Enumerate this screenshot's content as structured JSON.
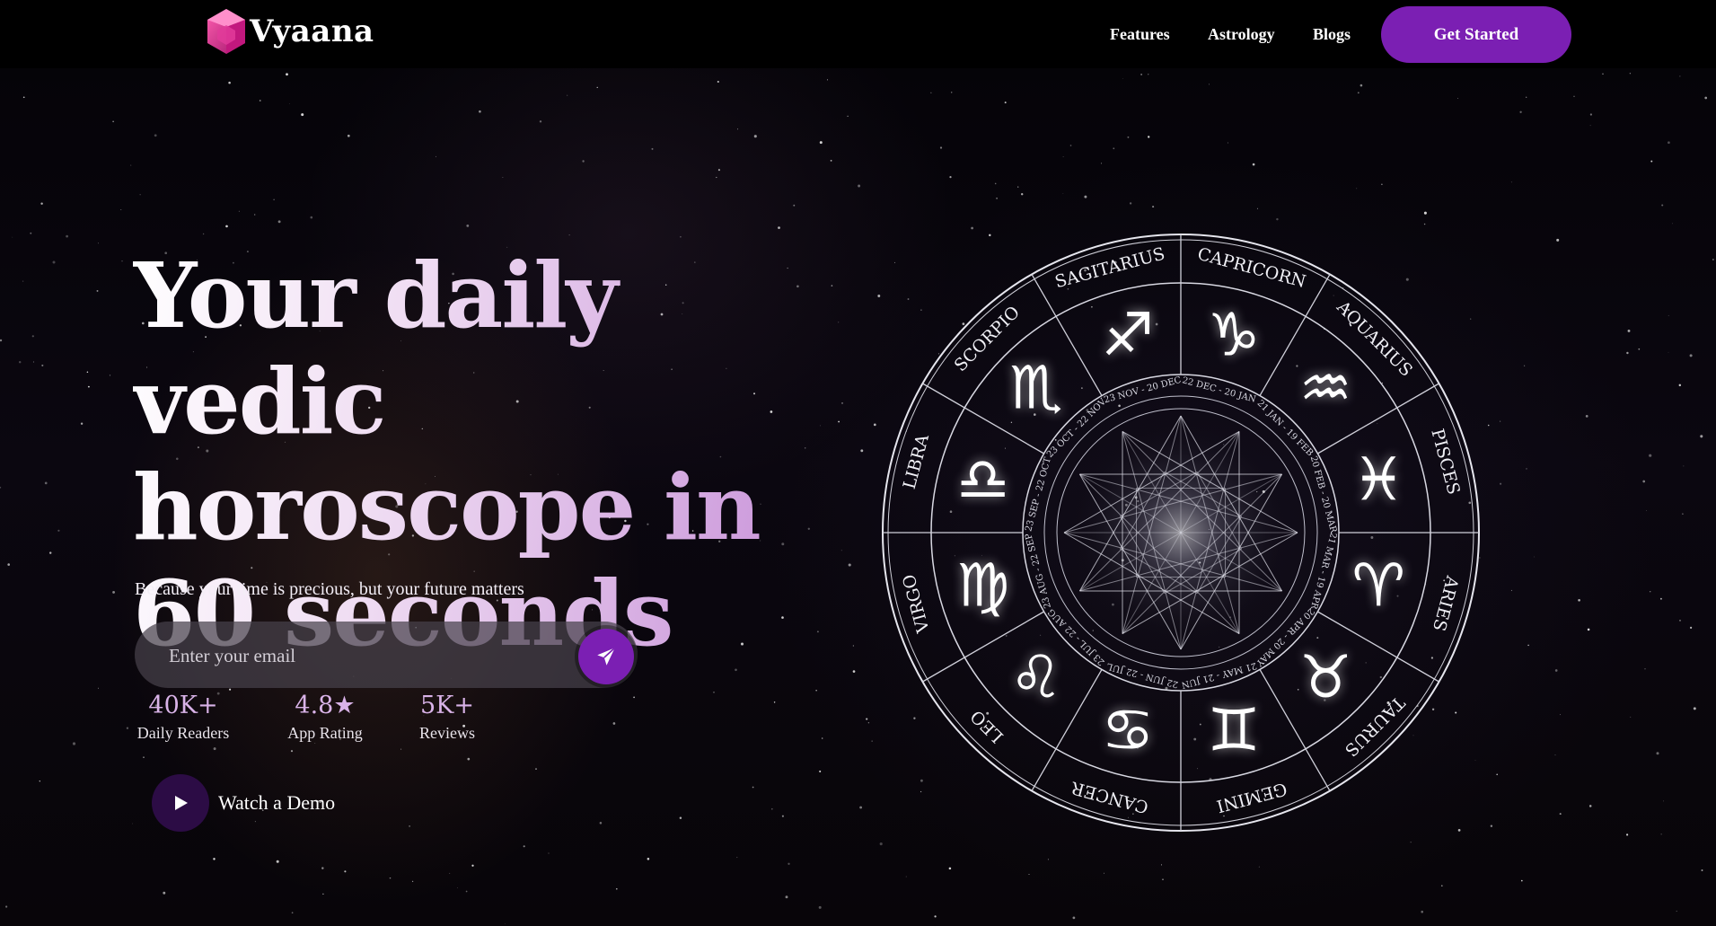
{
  "brand": {
    "name": "Vyaana",
    "logo_icon": "gem-logo-icon"
  },
  "nav": {
    "links": [
      "Features",
      "Astrology",
      "Blogs"
    ],
    "cta_label": "Get Started"
  },
  "hero": {
    "headline": "Your daily vedic horoscope in 60 seconds",
    "subtitle": "Because your time is precious, but your future matters",
    "email_placeholder": "Enter your email",
    "send_icon": "paper-plane-icon",
    "stats": [
      {
        "value": "40K+",
        "label": "Daily Readers"
      },
      {
        "value": "4.8★",
        "label": "App Rating"
      },
      {
        "value": "5K+",
        "label": "Reviews"
      }
    ],
    "demo_label": "Watch a Demo",
    "demo_icon": "play-icon"
  },
  "zodiac_wheel": {
    "signs": [
      "SAGITARIUS",
      "CAPRICORN",
      "AQUARIUS",
      "PISCES",
      "ARIES",
      "TAURUS",
      "GEMINI",
      "CANCER",
      "LEO",
      "VIRGO",
      "LIBRA",
      "SCORPIO"
    ],
    "symbols": [
      "♐",
      "♑",
      "♒",
      "♓",
      "♈",
      "♉",
      "♊",
      "♋",
      "♌",
      "♍",
      "♎",
      "♏"
    ],
    "dates": [
      "23 NOV - 20 DEC",
      "22 DEC - 20 JAN",
      "21 JAN - 19 FEB",
      "20 FEB - 20 MAR",
      "21 MAR - 19 APR",
      "20 APR - 20 MAY",
      "21 MAY - 21 JUN",
      "22 JUN - 22 JUL",
      "23 JUL - 22 AUG",
      "23 AUG - 22 SEP",
      "23 SEP - 22 OCT",
      "23 OCT - 22 NOV"
    ]
  },
  "colors": {
    "accent": "#7b1fb3",
    "background": "#050308",
    "stat_value": "#d9b3e8"
  }
}
